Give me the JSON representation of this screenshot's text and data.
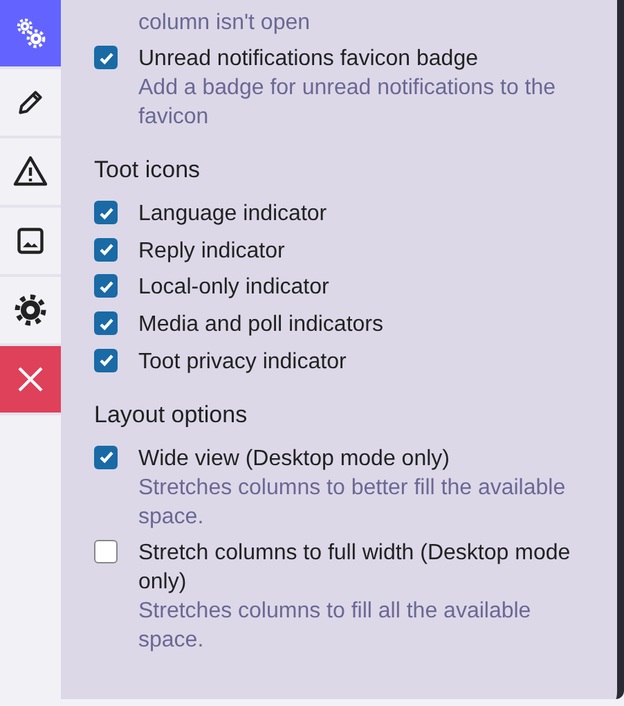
{
  "sidebar": {
    "tabs": [
      {
        "kind": "gears",
        "selected": true
      },
      {
        "kind": "pencil",
        "selected": false
      },
      {
        "kind": "warning",
        "selected": false
      },
      {
        "kind": "image",
        "selected": false
      },
      {
        "kind": "gear",
        "selected": false
      },
      {
        "kind": "close",
        "selected": false
      }
    ]
  },
  "cut_off_description": "column isn't open",
  "sections": [
    {
      "options": [
        {
          "label": "Unread notifications favicon badge",
          "checked": true,
          "description": "Add a badge for unread notifications to the favicon"
        }
      ]
    },
    {
      "heading": "Toot icons",
      "options": [
        {
          "label": "Language indicator",
          "checked": true
        },
        {
          "label": "Reply indicator",
          "checked": true
        },
        {
          "label": "Local-only indicator",
          "checked": true
        },
        {
          "label": "Media and poll indicators",
          "checked": true
        },
        {
          "label": "Toot privacy indicator",
          "checked": true
        }
      ]
    },
    {
      "heading": "Layout options",
      "options": [
        {
          "label": "Wide view (Desktop mode only)",
          "checked": true,
          "description": "Stretches columns to better fill the available space."
        },
        {
          "label": "Stretch columns to full width (Desktop mode only)",
          "checked": false,
          "description": "Stretches columns to fill all the available space."
        }
      ]
    }
  ]
}
